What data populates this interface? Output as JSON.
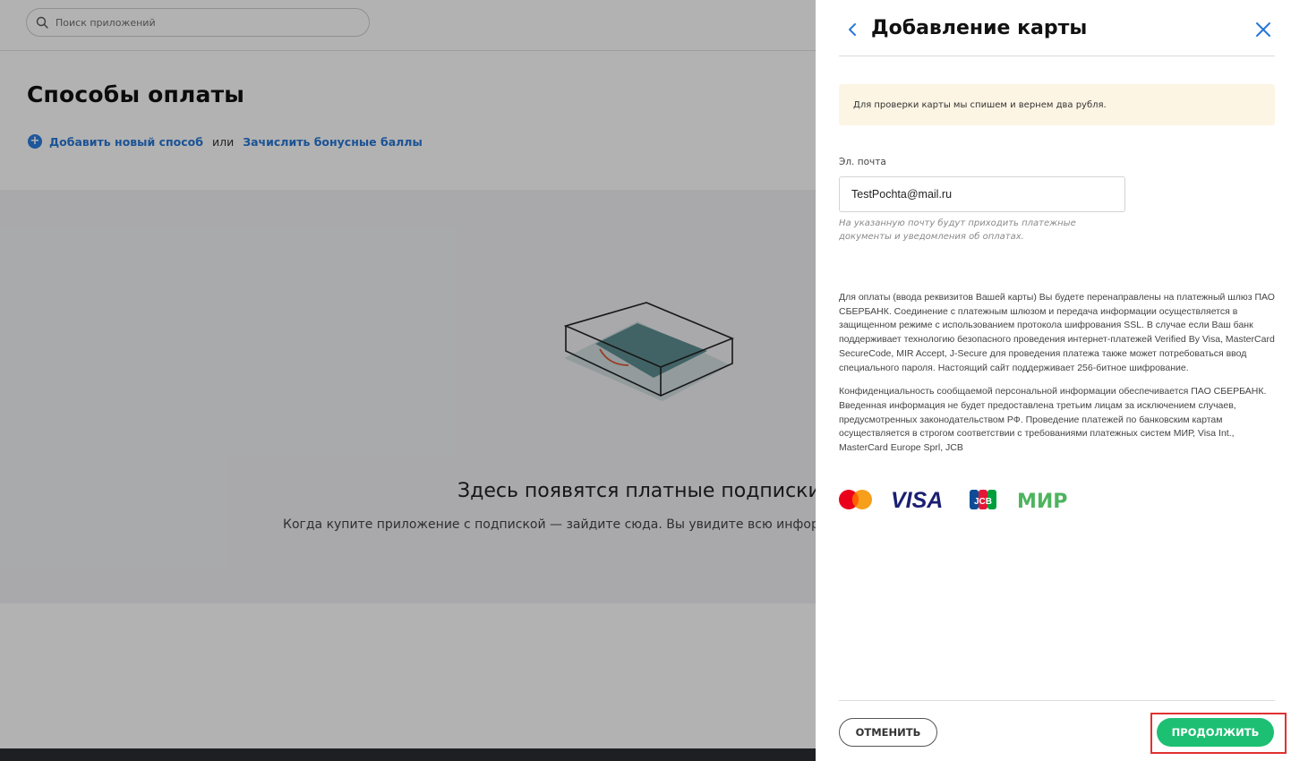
{
  "search": {
    "placeholder": "Поиск приложений"
  },
  "page": {
    "title": "Способы оплаты",
    "add_method": "Добавить новый способ",
    "or": "или",
    "bonus": "Зачислить бонусные баллы",
    "empty_title": "Здесь появятся платные подписки",
    "empty_sub": "Когда купите приложение с подпиской — зайдите сюда. Вы увидите всю информацию"
  },
  "drawer": {
    "title": "Добавление карты",
    "notice": "Для проверки карты мы спишем и вернем два рубля.",
    "email_label": "Эл. почта",
    "email_value": "TestPochta@mail.ru",
    "email_hint": "На указанную почту будут приходить платежные документы и уведомления об оплатах.",
    "legal_1": "Для оплаты (ввода реквизитов Вашей карты) Вы будете перенаправлены на платежный шлюз ПАО СБЕРБАНК. Соединение с платежным шлюзом и передача информации осуществляется в защищенном режиме с использованием протокола шифрования SSL. В случае если Ваш банк поддерживает технологию безопасного проведения интернет-платежей Verified By Visa, MasterCard SecureCode, MIR Accept, J-Secure для проведения платежа также может потребоваться ввод специального пароля. Настоящий сайт поддерживает 256-битное шифрование.",
    "legal_2": "Конфиденциальность сообщаемой персональной информации обеспечивается ПАО СБЕРБАНК. Введенная информация не будет предоставлена третьим лицам за исключением случаев, предусмотренных законодательством РФ. Проведение платежей по банковским картам осуществляется в строгом соответствии с требованиями платежных систем МИР, Visa Int., MasterCard Europe Sprl, JCB",
    "logos": {
      "visa": "VISA",
      "jcb": "JCB",
      "mir": "МИР"
    },
    "cancel": "ОТМЕНИТЬ",
    "continue": "ПРОДОЛЖИТЬ"
  },
  "colors": {
    "accent_green": "#1dbf73",
    "link_blue": "#2777d6",
    "highlight_red": "#e0312f",
    "notice_bg": "#fdf5e4"
  }
}
